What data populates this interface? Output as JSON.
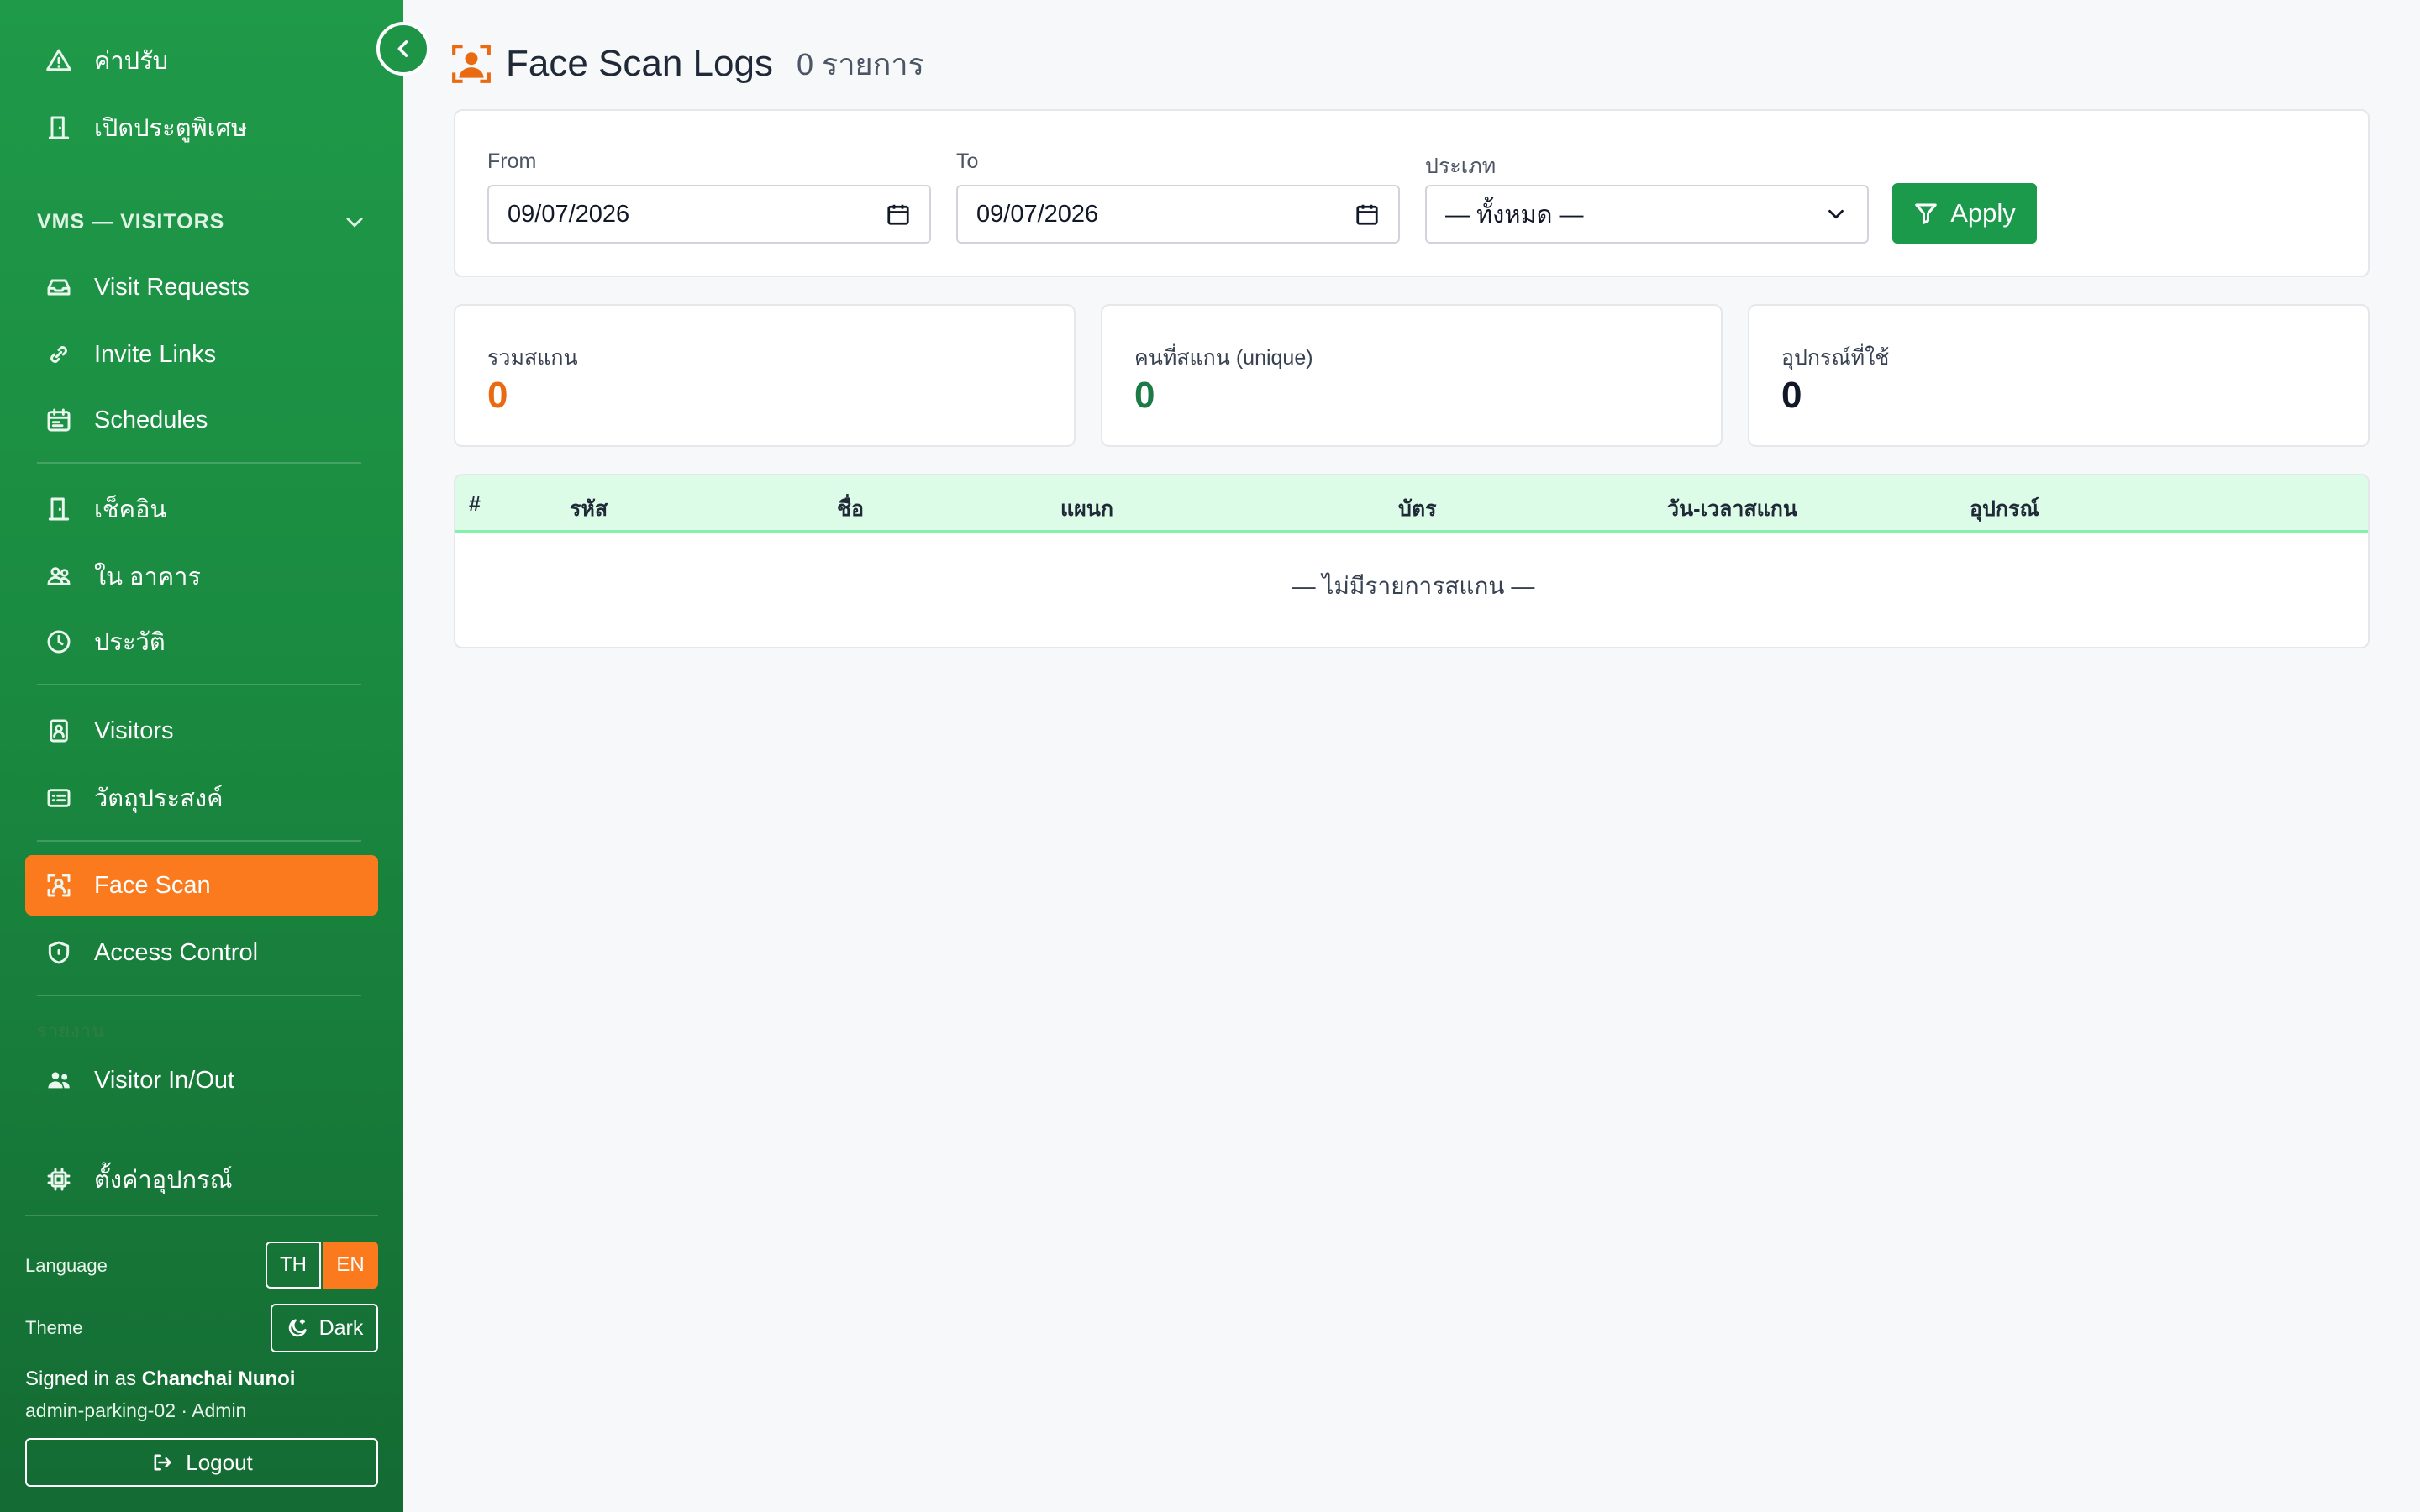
{
  "sidebar": {
    "items_top": [
      {
        "label": "ค่าปรับ",
        "icon": "warning-icon"
      },
      {
        "label": "เปิดประตูพิเศษ",
        "icon": "door-icon"
      }
    ],
    "section_vms": "VMS — VISITORS",
    "vms_items": [
      {
        "label": "Visit Requests",
        "icon": "inbox-icon"
      },
      {
        "label": "Invite Links",
        "icon": "link-icon"
      },
      {
        "label": "Schedules",
        "icon": "calendar-icon"
      }
    ],
    "checkin_items": [
      {
        "label": "เช็คอิน",
        "icon": "door-icon"
      },
      {
        "label": "ใน อาคาร",
        "icon": "people-icon"
      },
      {
        "label": "ประวัติ",
        "icon": "clock-icon"
      }
    ],
    "visitor_items": [
      {
        "label": "Visitors",
        "icon": "badge-icon"
      },
      {
        "label": "วัตถุประสงค์",
        "icon": "card-list-icon"
      }
    ],
    "face_items": [
      {
        "label": "Face Scan",
        "icon": "face-scan-icon",
        "active": true
      },
      {
        "label": "Access Control",
        "icon": "shield-icon"
      }
    ],
    "section_report": "รายงาน",
    "report_items": [
      {
        "label": "Visitor In/Out",
        "icon": "people-fill-icon"
      }
    ],
    "settings_item": {
      "label": "ตั้งค่าอุปกรณ์",
      "icon": "cpu-icon"
    },
    "language_label": "Language",
    "lang_th": "TH",
    "lang_en": "EN",
    "theme_label": "Theme",
    "theme_button": "Dark",
    "signed_in_prefix": "Signed in as",
    "user_name": "Chanchai Nunoi",
    "user_role": "admin-parking-02 · Admin",
    "logout": "Logout"
  },
  "header": {
    "title": "Face Scan Logs",
    "count": "0 รายการ"
  },
  "filters": {
    "from_label": "From",
    "from_value": "09/07/2026",
    "to_label": "To",
    "to_value": "09/07/2026",
    "type_label": "ประเภท",
    "type_value": "— ทั้งหมด —",
    "apply": "Apply"
  },
  "stats": [
    {
      "label": "รวมสแกน",
      "value": "0",
      "color": "#ea6a12"
    },
    {
      "label": "คนที่สแกน (unique)",
      "value": "0",
      "color": "#1b7a45"
    },
    {
      "label": "อุปกรณ์ที่ใช้",
      "value": "0",
      "color": "#111827"
    }
  ],
  "table": {
    "columns": [
      "#",
      "รหัส",
      "ชื่อ",
      "แผนก",
      "บัตร",
      "วัน-เวลาสแกน",
      "อุปกรณ์"
    ],
    "empty": "— ไม่มีรายการสแกน —"
  },
  "colors": {
    "brand_green": "#1f9a49",
    "accent_orange": "#fb7a1e",
    "apply_green": "#1b9a4b"
  }
}
